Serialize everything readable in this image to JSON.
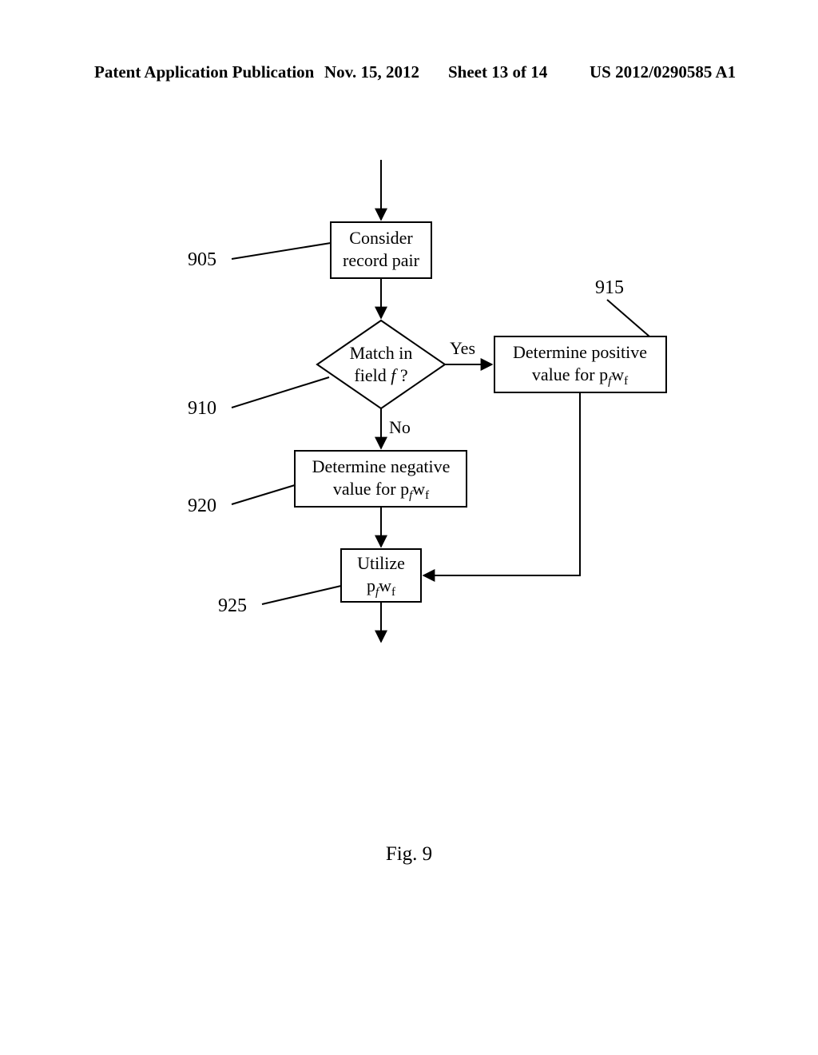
{
  "header": {
    "left": "Patent Application Publication",
    "date": "Nov. 15, 2012",
    "sheet": "Sheet 13 of 14",
    "pubno": "US 2012/0290585 A1"
  },
  "figure_label": "Fig. 9",
  "nodes": {
    "n905": {
      "ref": "905",
      "line1": "Consider",
      "line2": "record pair"
    },
    "n910": {
      "ref": "910",
      "line1": "Match in",
      "line2_a": "field ",
      "line2_b": "f",
      "line2_c": " ?"
    },
    "n915": {
      "ref": "915",
      "line1": "Determine positive",
      "line2_a": "value for p",
      "line2_sub1": "f",
      "line2_b": "w",
      "line2_sub2": "f"
    },
    "n920": {
      "ref": "920",
      "line1": "Determine negative",
      "line2_a": "value for p",
      "line2_sub1": "f",
      "line2_b": "w",
      "line2_sub2": "f"
    },
    "n925": {
      "ref": "925",
      "line1": "Utilize",
      "line2_a": "p",
      "line2_sub1": "f",
      "line2_b": "w",
      "line2_sub2": "f"
    }
  },
  "edges": {
    "yes": "Yes",
    "no": "No"
  }
}
